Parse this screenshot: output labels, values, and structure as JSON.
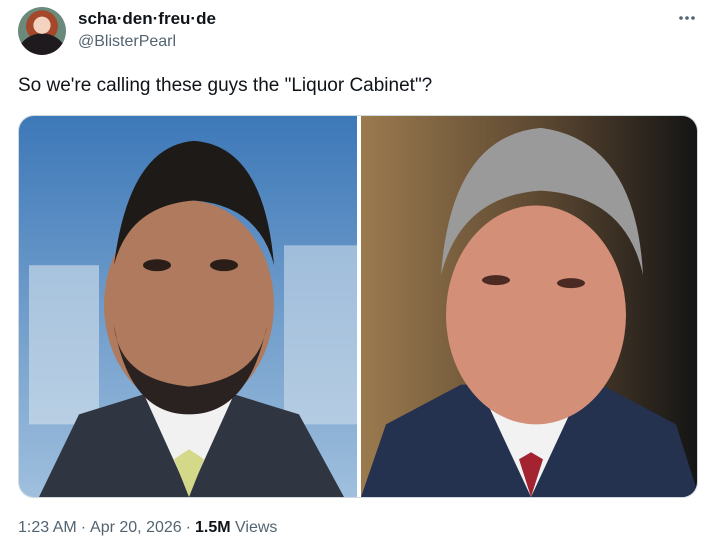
{
  "author": {
    "display_name": "scha·den·freu·de",
    "handle": "@BlisterPearl"
  },
  "tweet": {
    "text": "So we're calling these guys the \"Liquor Cabinet\"?"
  },
  "meta": {
    "time": "1:23 AM",
    "date": "Apr 20, 2026",
    "views_count": "1.5M",
    "views_label": "Views",
    "separator": "·"
  },
  "icons": {
    "more": "more-dots-icon"
  },
  "colors": {
    "text": "#0f1419",
    "secondary": "#536471",
    "border": "#cfd9de"
  }
}
